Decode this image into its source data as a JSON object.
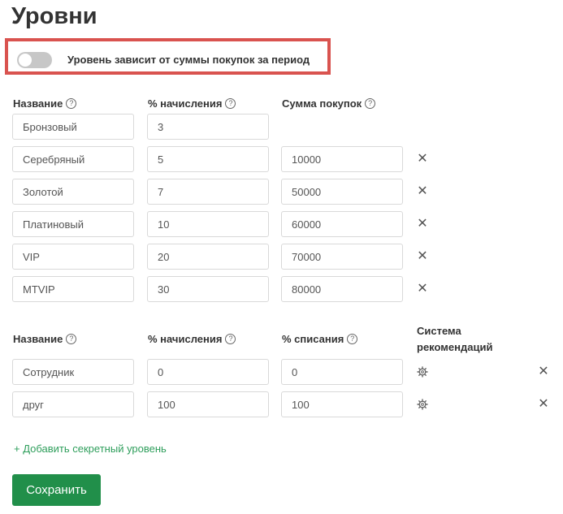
{
  "page_title": "Уровни",
  "toggle": {
    "label": "Уровень зависит от суммы покупок за период",
    "enabled": false
  },
  "help_glyph": "?",
  "close_glyph": "✕",
  "levels": {
    "headers": {
      "name": "Название",
      "accrual": "% начисления",
      "purchase_sum": "Сумма покупок"
    },
    "rows": [
      {
        "name": "Бронзовый",
        "accrual": "3",
        "purchase_sum": ""
      },
      {
        "name": "Серебряный",
        "accrual": "5",
        "purchase_sum": "10000"
      },
      {
        "name": "Золотой",
        "accrual": "7",
        "purchase_sum": "50000"
      },
      {
        "name": "Платиновый",
        "accrual": "10",
        "purchase_sum": "60000"
      },
      {
        "name": "VIP",
        "accrual": "20",
        "purchase_sum": "70000"
      },
      {
        "name": "MTVIP",
        "accrual": "30",
        "purchase_sum": "80000"
      }
    ]
  },
  "secret_levels": {
    "headers": {
      "name": "Название",
      "accrual": "% начисления",
      "writeoff": "% списания",
      "recommendation_line1": "Система",
      "recommendation_line2": "рекомендаций"
    },
    "rows": [
      {
        "name": "Сотрудник",
        "accrual": "0",
        "writeoff": "0"
      },
      {
        "name": "друг",
        "accrual": "100",
        "writeoff": "100"
      }
    ]
  },
  "add_secret_level_label": "+ Добавить секретный уровень",
  "save_label": "Сохранить",
  "colors": {
    "accent": "#218f4a",
    "link": "#2e9e5b",
    "highlight_border": "#d9534f",
    "toggle_off": "#c7c7c7"
  }
}
